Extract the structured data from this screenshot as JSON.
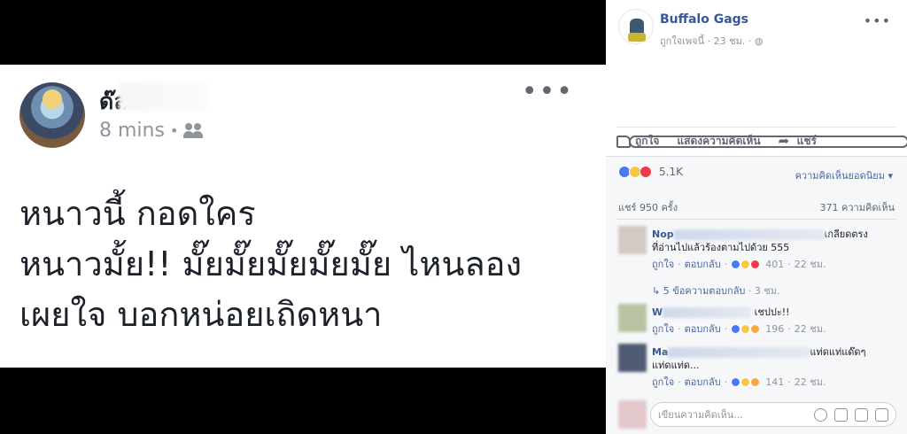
{
  "post": {
    "author_visible": "ด๊ล",
    "time": "8 mins",
    "text": "หนาวนี้ กอดใคร\nหนาวมั้ย!! มั๊ยมั๊ยมั๊ยมั๊ยมั๊ย ไหนลอง\nเผยใจ บอกหน่อยเถิดหนา"
  },
  "page": {
    "name": "Buffalo Gags",
    "liked_label": "ถูกใจเพจนี้",
    "time": "23 ชม."
  },
  "actions": {
    "like": "ถูกใจ",
    "comment": "แสดงความคิดเห็น",
    "share": "แชร์"
  },
  "stats": {
    "reactions": "5.1K",
    "sort": "ความคิดเห็นยอดนิยม ▾",
    "shares": "แชร์ 950 ครั้ง",
    "comments": "371 ความคิดเห็น"
  },
  "comments": [
    {
      "author": "Nop",
      "text_tail": "เกลียดตรง",
      "text2": "ที่อ่านไปแล้วร้องตามไปด้วย 555",
      "like": "ถูกใจ",
      "reply": "ตอบกลับ",
      "count": "401",
      "time": "22 ชม."
    },
    {
      "author": "W",
      "text_tail": "เชปปะ!!",
      "like": "ถูกใจ",
      "reply": "ตอบกลับ",
      "count": "196",
      "time": "22 ชม."
    },
    {
      "author": "Ma",
      "text_tail": "แท่ดแท่แด๊ดๆ",
      "text2": "แท่ดแท่ด...",
      "like": "ถูกใจ",
      "reply": "ตอบกลับ",
      "count": "141",
      "time": "22 ชม."
    }
  ],
  "replies_link": "5 ข้อความตอบกลับ",
  "replies_time": "3 ชม.",
  "composer": {
    "placeholder": "เขียนความคิดเห็น..."
  },
  "colors": {
    "link": "#365899",
    "accent": "#4b67a1"
  }
}
